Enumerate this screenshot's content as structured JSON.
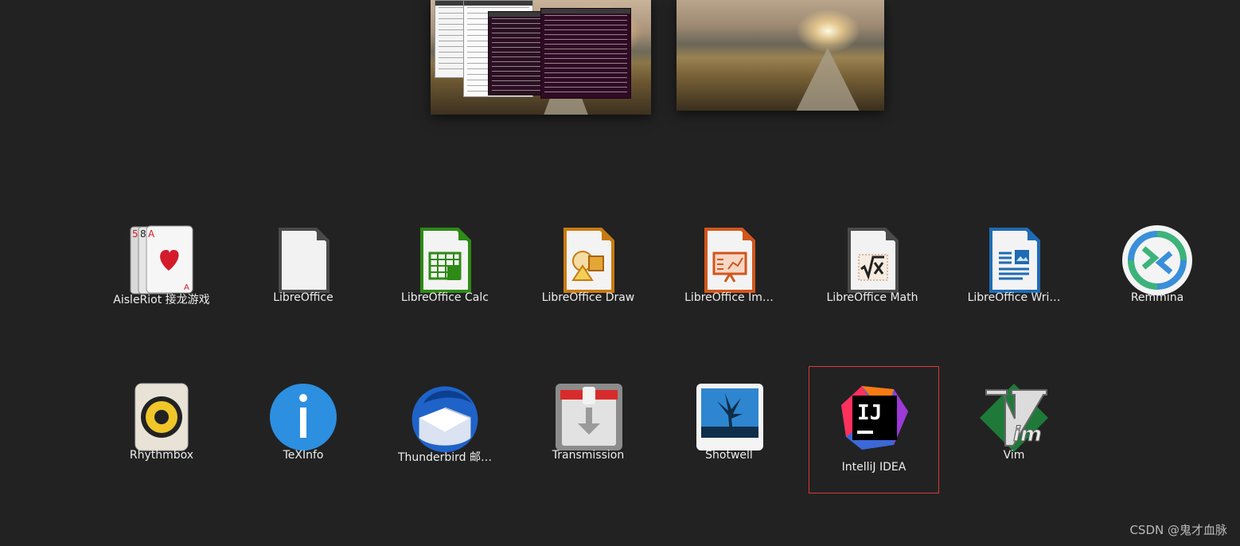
{
  "apps_row1": [
    {
      "name": "AisleRiot 接龙游戏",
      "icon": "aisleriot-cards-icon"
    },
    {
      "name": "LibreOffice",
      "icon": "libreoffice-icon"
    },
    {
      "name": "LibreOffice Calc",
      "icon": "libreoffice-calc-icon"
    },
    {
      "name": "LibreOffice Draw",
      "icon": "libreoffice-draw-icon"
    },
    {
      "name": "LibreOffice Im…",
      "icon": "libreoffice-impress-icon"
    },
    {
      "name": "LibreOffice Math",
      "icon": "libreoffice-math-icon"
    },
    {
      "name": "LibreOffice Wri…",
      "icon": "libreoffice-writer-icon"
    },
    {
      "name": "Remmina",
      "icon": "remmina-icon"
    }
  ],
  "apps_row2": [
    {
      "name": "Rhythmbox",
      "icon": "rhythmbox-speaker-icon"
    },
    {
      "name": "TeXInfo",
      "icon": "texinfo-info-icon"
    },
    {
      "name": "Thunderbird 邮…",
      "icon": "thunderbird-icon"
    },
    {
      "name": "Transmission",
      "icon": "transmission-icon"
    },
    {
      "name": "Shotwell",
      "icon": "shotwell-icon"
    },
    {
      "name": "IntelliJ IDEA",
      "icon": "intellij-idea-icon",
      "selected": true
    },
    {
      "name": "Vim",
      "icon": "vim-icon"
    }
  ],
  "colors": {
    "background": "#222222",
    "selection_outline": "#d83a3a",
    "label_text": "#eeeeee"
  },
  "watermark": "CSDN @鬼才血脉"
}
